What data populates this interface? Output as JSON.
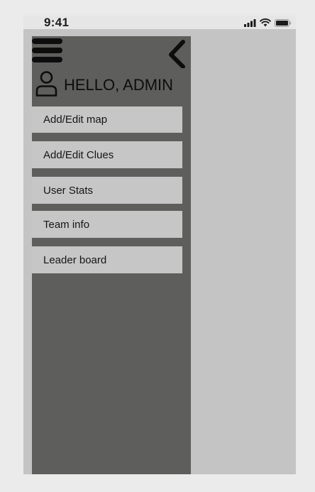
{
  "status_bar": {
    "time": "9:41",
    "icons": [
      "signal-icon",
      "wifi-icon",
      "battery-icon"
    ]
  },
  "drawer": {
    "menu_icon": "hamburger-menu-icon",
    "back_icon": "chevron-left-icon",
    "user_icon": "user-icon",
    "greeting": "HELLO, ADMIN",
    "items": [
      {
        "label": "Add/Edit map"
      },
      {
        "label": "Add/Edit Clues"
      },
      {
        "label": "User Stats"
      },
      {
        "label": "Team info"
      },
      {
        "label": "Leader board"
      }
    ]
  },
  "colors": {
    "page_background": "#ebebeb",
    "screen_background": "#c4c4c4",
    "status_bar_background": "#e6e6e6",
    "drawer_background": "#5e5f5d",
    "menu_item_background": "#c6c6c6",
    "icon_color": "#0d0d0d"
  }
}
